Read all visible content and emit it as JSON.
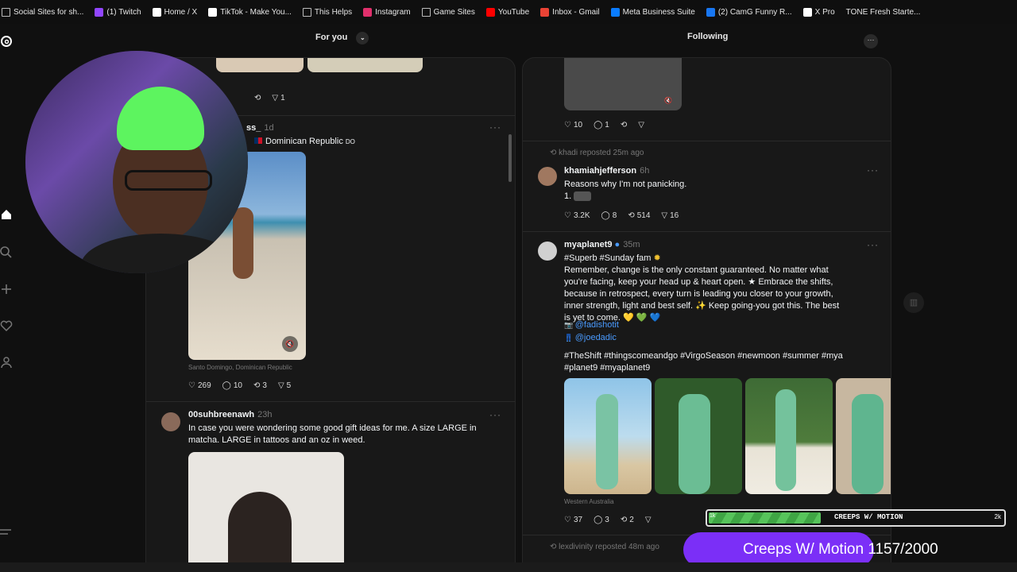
{
  "bookmarks": [
    {
      "label": "Social Sites for sh...",
      "icon": "folder-icon",
      "color": ""
    },
    {
      "label": "(1) Twitch",
      "icon": "twitch-icon",
      "color": "#9146ff"
    },
    {
      "label": "Home / X",
      "icon": "x-icon",
      "color": "#ffffff"
    },
    {
      "label": "TikTok - Make You...",
      "icon": "tiktok-icon",
      "color": "#ffffff"
    },
    {
      "label": "This Helps",
      "icon": "folder-icon",
      "color": ""
    },
    {
      "label": "Instagram",
      "icon": "instagram-icon",
      "color": "#e1306c"
    },
    {
      "label": "Game Sites",
      "icon": "folder-icon",
      "color": ""
    },
    {
      "label": "YouTube",
      "icon": "youtube-icon",
      "color": "#ff0000"
    },
    {
      "label": "Inbox - Gmail",
      "icon": "gmail-icon",
      "color": "#ea4335"
    },
    {
      "label": "Meta Business Suite",
      "icon": "meta-icon",
      "color": "#0a7cff"
    },
    {
      "label": "(2) CamG Funny R...",
      "icon": "facebook-icon",
      "color": "#1877f2"
    },
    {
      "label": "X Pro",
      "icon": "x-icon",
      "color": "#ffffff"
    },
    {
      "label": "TONE Fresh Starte...",
      "icon": "blank-icon",
      "color": ""
    }
  ],
  "columns": {
    "for_you_title": "For you",
    "following_title": "Following"
  },
  "for_you": {
    "top_repost_count": "1",
    "post1": {
      "username": "ss_",
      "time": "1d",
      "text": "Dominican Republic",
      "flag_text": "DO",
      "location": "Santo Domingo, Dominican Republic",
      "likes": "269",
      "replies": "10",
      "reposts": "3",
      "shares": "5"
    },
    "post2": {
      "username": "00suhbreenawh",
      "time": "23h",
      "text": "In case you were wondering some good gift ideas for me. A size LARGE in matcha. LARGE in tattoos and an oz in weed."
    }
  },
  "following": {
    "top_post": {
      "likes": "10",
      "replies": "1"
    },
    "repost_label_1": "khadi reposted 25m ago",
    "post1": {
      "username": "khamiahjefferson",
      "time": "6h",
      "line1": "Reasons why I'm not panicking.",
      "line2": "1.",
      "likes": "3.2K",
      "replies": "8",
      "reposts": "514",
      "shares": "16"
    },
    "post2": {
      "username": "myaplanet9",
      "time": "35m",
      "line1": "#Superb #Sunday fam",
      "body": "Remember, change is the only constant guaranteed. No matter what you're facing, keep your head up & heart open. ★ Embrace the shifts, because in retrospect, every turn is leading you closer to your growth, inner strength, light and best self. ✨ Keep going-you got this. The best is yet to come. 💛 💚 💙",
      "mention1": "@fadishotit",
      "mention2": "@joedadic",
      "tags": "#TheShift #thingscomeandgo #VirgoSeason #newmoon #summer #mya #planet9 #myaplanet9",
      "location": "Western Australia",
      "likes": "37",
      "replies": "3",
      "reposts": "2"
    },
    "repost_label_2": "lexdivinity reposted 48m ago"
  },
  "overlay": {
    "progress_label": "CREEPS W/ MOTION",
    "progress_start": "1k",
    "progress_end": "2k",
    "progress_fraction": 0.38,
    "goal_label": "Creeps W/ Motion",
    "goal_count": "1157/2000",
    "goal_color": "#7b2ff7"
  }
}
